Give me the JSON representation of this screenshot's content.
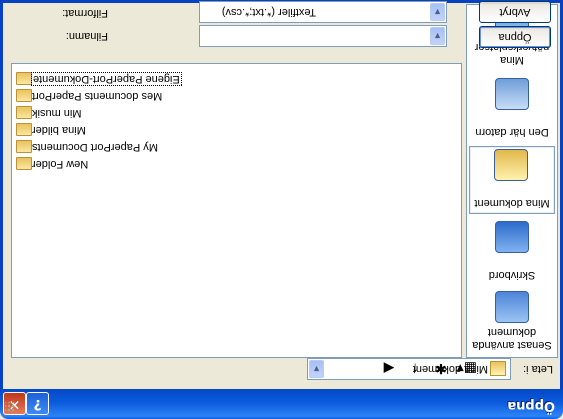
{
  "window": {
    "title": "Öppna",
    "help_glyph": "?",
    "close_glyph": "✕"
  },
  "lookin": {
    "label": "Leta i:",
    "value": "Mina dokument"
  },
  "toolbar": [
    {
      "name": "back-icon",
      "glyph": "◀"
    },
    {
      "name": "up-folder-icon",
      "glyph": "↑"
    },
    {
      "name": "new-folder-icon",
      "glyph": "✱"
    },
    {
      "name": "views-menu-icon",
      "glyph": "▦▾"
    }
  ],
  "files": [
    {
      "name": "Eigene PaperPort-Dokumente",
      "selected": true
    },
    {
      "name": "Mes documents PaperPort",
      "selected": false
    },
    {
      "name": "Min musik",
      "selected": false
    },
    {
      "name": "Mina bilder",
      "selected": false
    },
    {
      "name": "My PaperPort Documents",
      "selected": false
    },
    {
      "name": "New Folder",
      "selected": false
    }
  ],
  "places": [
    {
      "label": "Senast använda dokument",
      "icon": "recent-documents-icon",
      "active": false
    },
    {
      "label": "Skrivbord",
      "icon": "desktop-icon",
      "active": false
    },
    {
      "label": "Mina dokument",
      "icon": "my-documents-icon",
      "active": true
    },
    {
      "label": "Den här datorn",
      "icon": "my-computer-icon",
      "active": false
    },
    {
      "label": "Mina nätverksplatser",
      "icon": "network-places-icon",
      "active": false
    }
  ],
  "filename": {
    "label": "Filnamn:",
    "value": ""
  },
  "filetype": {
    "label": "Filformat:",
    "value": "Textfiler (*.txt;*.csv)"
  },
  "buttons": {
    "open": "Öppna",
    "cancel": "Avbryt"
  }
}
